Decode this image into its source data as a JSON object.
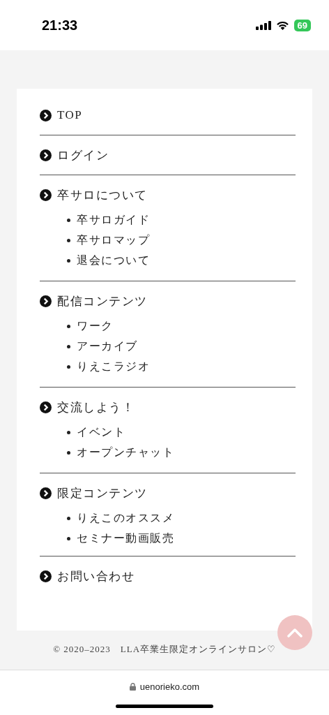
{
  "status_bar": {
    "time": "21:33",
    "battery": "69"
  },
  "menu": [
    {
      "label": "TOP"
    },
    {
      "label": "ログイン"
    },
    {
      "label": "卒サロについて",
      "children": [
        "卒サロガイド",
        "卒サロマップ",
        "退会について"
      ]
    },
    {
      "label": "配信コンテンツ",
      "children": [
        "ワーク",
        "アーカイブ",
        "りえこラジオ"
      ]
    },
    {
      "label": "交流しよう！",
      "children": [
        "イベント",
        "オープンチャット"
      ]
    },
    {
      "label": "限定コンテンツ",
      "children": [
        "りえこのオススメ",
        "セミナー動画販売"
      ]
    },
    {
      "label": "お問い合わせ"
    }
  ],
  "footer": {
    "copyright": "© 2020–2023　LLA卒業生限定オンラインサロン♡"
  },
  "browser": {
    "url": "uenorieko.com"
  }
}
